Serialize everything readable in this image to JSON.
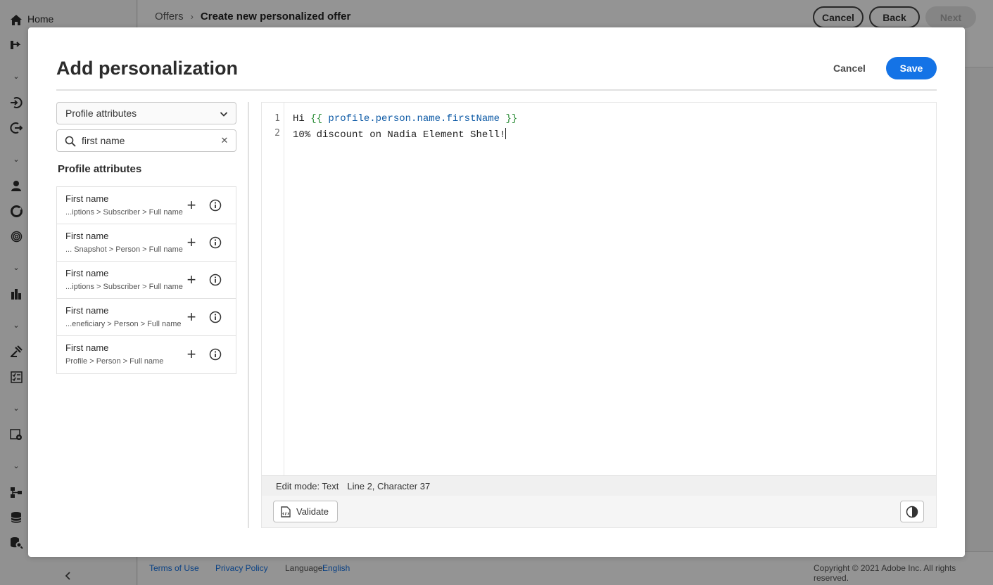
{
  "app": {
    "nav": {
      "home_label": "Home",
      "collapse_icon": "chevron-left-icon"
    },
    "breadcrumb": {
      "parent": "Offers",
      "current": "Create new personalized offer"
    },
    "header_buttons": {
      "cancel": "Cancel",
      "back": "Back",
      "next": "Next"
    },
    "footer": {
      "terms": "Terms of Use",
      "privacy": "Privacy Policy",
      "language_label": "Language:",
      "language_value": "English",
      "copyright": "Copyright ©  2021 Adobe Inc. All rights reserved."
    }
  },
  "modal": {
    "title": "Add personalization",
    "cancel_label": "Cancel",
    "save_label": "Save",
    "save_color": "#1473e6",
    "left_panel": {
      "dropdown_value": "Profile attributes",
      "search_value": "first name",
      "section_title": "Profile attributes",
      "attributes": [
        {
          "name": "First name",
          "path": "...iptions > Subscriber > Full name"
        },
        {
          "name": "First name",
          "path": "... Snapshot > Person > Full name"
        },
        {
          "name": "First name",
          "path": "...iptions > Subscriber > Full name"
        },
        {
          "name": "First name",
          "path": "...eneficiary > Person > Full name"
        },
        {
          "name": "First name",
          "path": "Profile > Person > Full name"
        }
      ]
    },
    "editor": {
      "line_numbers": [
        "1",
        "2"
      ],
      "line1": {
        "prefix": "Hi ",
        "open": "{{",
        "expression": " profile.person.name.firstName ",
        "close": "}}"
      },
      "line2": "10% discount on Nadia Element Shell!",
      "status_mode": "Edit mode: Text",
      "status_position": "Line 2, Character 37",
      "validate_label": "Validate"
    }
  }
}
